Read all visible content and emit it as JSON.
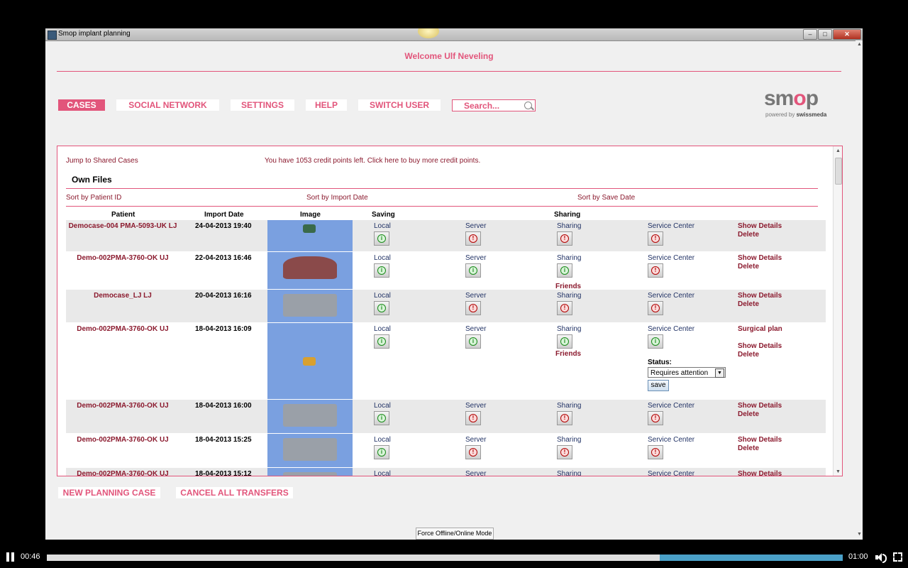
{
  "window": {
    "title": "Smop implant planning",
    "controls": [
      "–",
      "□",
      "✕"
    ]
  },
  "header": {
    "welcome": "Welcome Ulf Neveling"
  },
  "nav": {
    "items": [
      "CASES",
      "SOCIAL NETWORK",
      "SETTINGS",
      "HELP",
      "SWITCH USER"
    ],
    "active": "CASES"
  },
  "search": {
    "placeholder": "Search..."
  },
  "logo": {
    "text_pre": "sm",
    "text_o": "o",
    "text_post": "p",
    "sub_pre": "powered by ",
    "sub_brand": "swissmeda"
  },
  "panel": {
    "jump_link": "Jump to Shared Cases",
    "credit_text": "You have 1053 credit points left. Click here to buy more credit points.",
    "own_files": "Own Files",
    "sort": [
      "Sort by Patient ID",
      "Sort by Import Date",
      "Sort by Save Date"
    ],
    "columns": [
      "Patient",
      "Import Date",
      "Image",
      "Saving",
      "Sharing"
    ]
  },
  "labels": {
    "local": "Local",
    "server": "Server",
    "sharing": "Sharing",
    "service_center": "Service Center",
    "show_details": "Show Details",
    "delete": "Delete",
    "friends": "Friends",
    "surgical_plan": "Surgical plan",
    "status": "Status:",
    "status_value": "Requires attention",
    "save": "save"
  },
  "rows": [
    {
      "patient": "Democase-004 PMA-5093-UK LJ",
      "date": "24-04-2013 19:40",
      "local": "ok",
      "server": "err",
      "sharing": "err",
      "service": "err"
    },
    {
      "patient": "Demo-002PMA-3760-OK UJ",
      "date": "22-04-2013 16:46",
      "local": "ok",
      "server": "ok",
      "sharing": "ok",
      "service": "err",
      "friends": true
    },
    {
      "patient": "Democase_LJ LJ",
      "date": "20-04-2013 16:16",
      "local": "ok",
      "server": "err",
      "sharing": "err",
      "service": "err"
    },
    {
      "patient": "Demo-002PMA-3760-OK UJ",
      "date": "18-04-2013 16:09",
      "local": "ok",
      "server": "ok",
      "sharing": "ok",
      "service": "ok",
      "friends": true,
      "surgical": true
    },
    {
      "patient": "Demo-002PMA-3760-OK UJ",
      "date": "18-04-2013 16:00",
      "local": "ok",
      "server": "err",
      "sharing": "err",
      "service": "err"
    },
    {
      "patient": "Demo-002PMA-3760-OK UJ",
      "date": "18-04-2013 15:25",
      "local": "ok",
      "server": "err",
      "sharing": "err",
      "service": "err"
    },
    {
      "patient": "Demo-002PMA-3760-OK UJ",
      "date": "18-04-2013 15:12",
      "local": "ok",
      "server": "err",
      "sharing": "err",
      "service": "err"
    }
  ],
  "footer": {
    "new_case": "NEW PLANNING CASE",
    "cancel_transfers": "CANCEL ALL TRANSFERS",
    "force_mode": "Force Offline/Online Mode"
  },
  "player": {
    "current": "00:46",
    "total": "01:00",
    "progress": 0.77
  },
  "colors": {
    "accent": "#e2557b",
    "link": "#8b1a2e",
    "image_bg": "#7aa0e0",
    "ok": "#1a8a1a",
    "err": "#b00000"
  }
}
